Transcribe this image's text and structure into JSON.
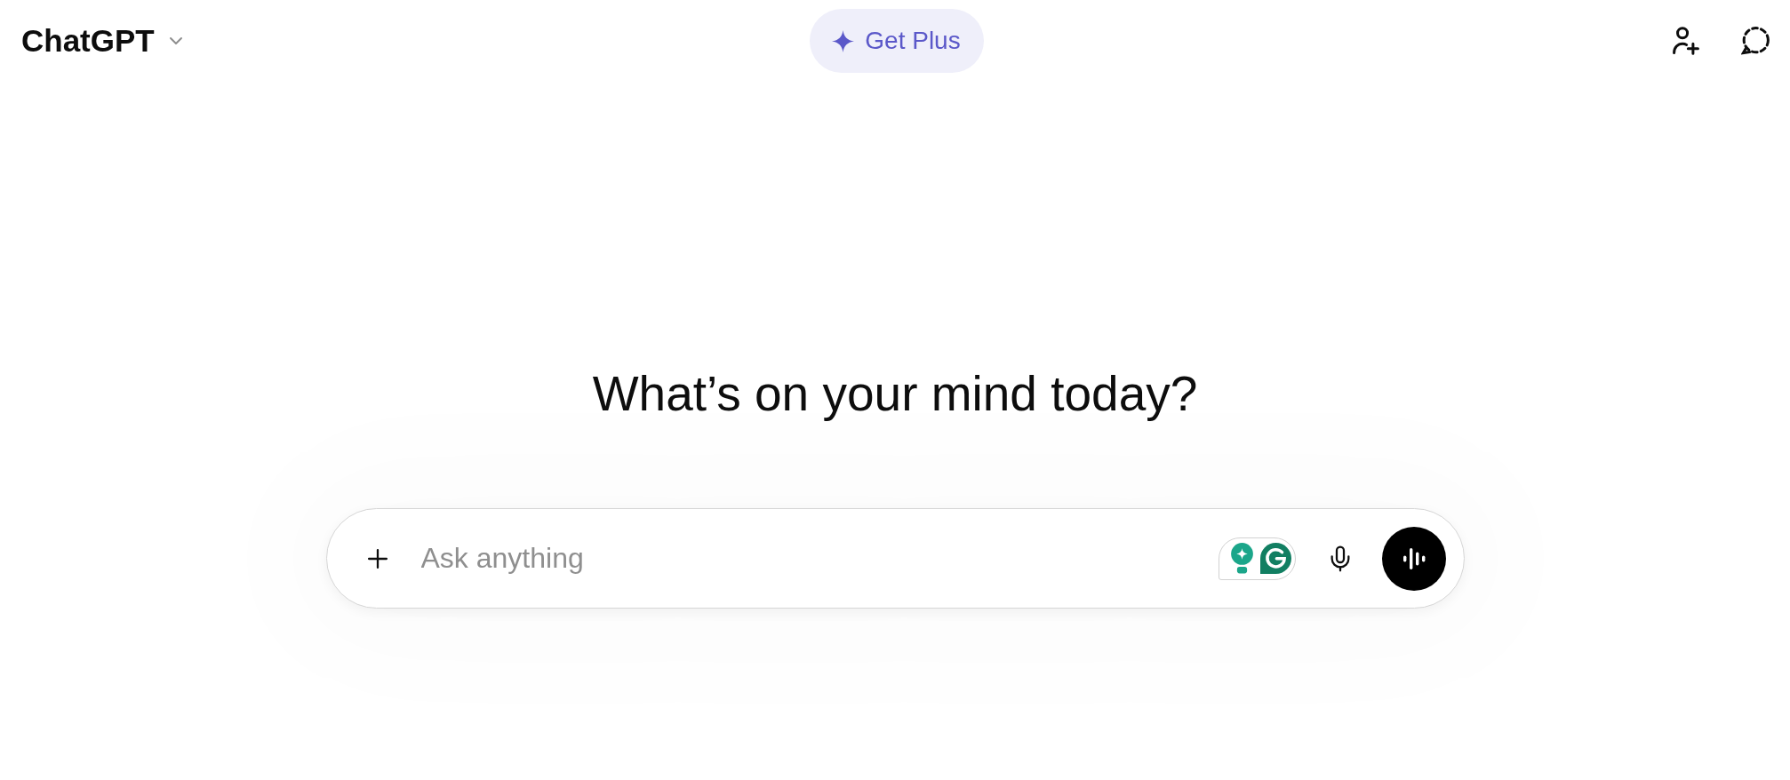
{
  "header": {
    "model_name": "ChatGPT",
    "upgrade_button": "Get Plus"
  },
  "heading": "What’s on your mind today?",
  "composer": {
    "placeholder": "Ask anything"
  }
}
